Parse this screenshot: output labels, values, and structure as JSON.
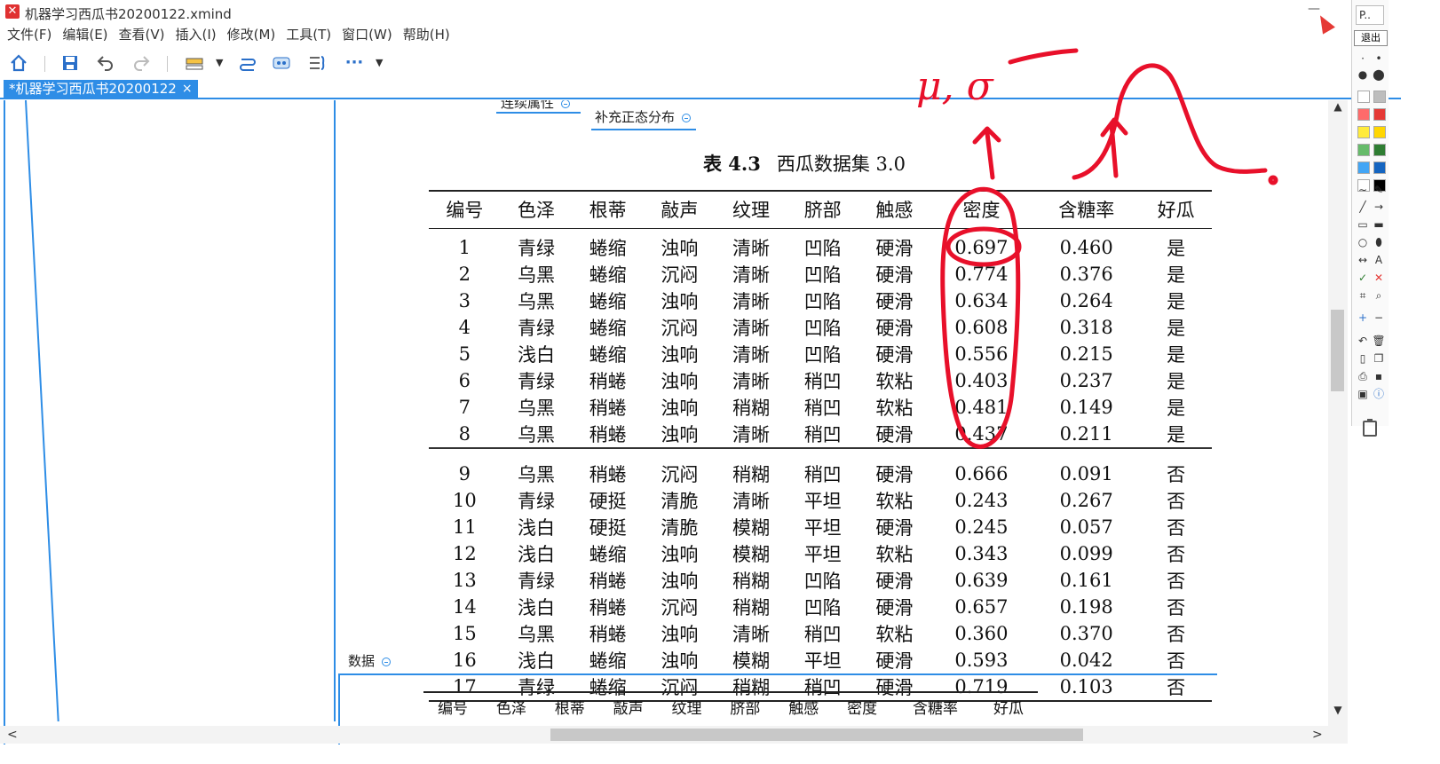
{
  "window": {
    "title": "机器学习西瓜书20200122.xmind",
    "logo_glyph": "✕",
    "minimize_glyph": "—"
  },
  "menu": [
    {
      "label": "文件(F)"
    },
    {
      "label": "编辑(E)"
    },
    {
      "label": "查看(V)"
    },
    {
      "label": "插入(I)"
    },
    {
      "label": "修改(M)"
    },
    {
      "label": "工具(T)"
    },
    {
      "label": "窗口(W)"
    },
    {
      "label": "帮助(H)"
    }
  ],
  "toolbar": {
    "icons": [
      "home-icon",
      "save-icon",
      "undo-icon",
      "redo-icon",
      "topic-icon",
      "relationship-icon",
      "boundary-icon",
      "summary-icon",
      "more-icon"
    ],
    "more_glyph": "···"
  },
  "tab": {
    "label": "*机器学习西瓜书20200122",
    "close_glyph": "×"
  },
  "mindmap": {
    "node_continuous": "连续属性",
    "node_supplement": "补充正态分布",
    "node_data": "数据"
  },
  "table_title": {
    "label": "表 4.3",
    "name": "西瓜数据集 3.0"
  },
  "table": {
    "headers": [
      "编号",
      "色泽",
      "根蒂",
      "敲声",
      "纹理",
      "脐部",
      "触感",
      "密度",
      "含糖率",
      "好瓜"
    ],
    "rows": [
      [
        "1",
        "青绿",
        "蜷缩",
        "浊响",
        "清晰",
        "凹陷",
        "硬滑",
        "0.697",
        "0.460",
        "是"
      ],
      [
        "2",
        "乌黑",
        "蜷缩",
        "沉闷",
        "清晰",
        "凹陷",
        "硬滑",
        "0.774",
        "0.376",
        "是"
      ],
      [
        "3",
        "乌黑",
        "蜷缩",
        "浊响",
        "清晰",
        "凹陷",
        "硬滑",
        "0.634",
        "0.264",
        "是"
      ],
      [
        "4",
        "青绿",
        "蜷缩",
        "沉闷",
        "清晰",
        "凹陷",
        "硬滑",
        "0.608",
        "0.318",
        "是"
      ],
      [
        "5",
        "浅白",
        "蜷缩",
        "浊响",
        "清晰",
        "凹陷",
        "硬滑",
        "0.556",
        "0.215",
        "是"
      ],
      [
        "6",
        "青绿",
        "稍蜷",
        "浊响",
        "清晰",
        "稍凹",
        "软粘",
        "0.403",
        "0.237",
        "是"
      ],
      [
        "7",
        "乌黑",
        "稍蜷",
        "浊响",
        "稍糊",
        "稍凹",
        "软粘",
        "0.481",
        "0.149",
        "是"
      ],
      [
        "8",
        "乌黑",
        "稍蜷",
        "浊响",
        "清晰",
        "稍凹",
        "硬滑",
        "0.437",
        "0.211",
        "是"
      ],
      [
        "9",
        "乌黑",
        "稍蜷",
        "沉闷",
        "稍糊",
        "稍凹",
        "硬滑",
        "0.666",
        "0.091",
        "否"
      ],
      [
        "10",
        "青绿",
        "硬挺",
        "清脆",
        "清晰",
        "平坦",
        "软粘",
        "0.243",
        "0.267",
        "否"
      ],
      [
        "11",
        "浅白",
        "硬挺",
        "清脆",
        "模糊",
        "平坦",
        "硬滑",
        "0.245",
        "0.057",
        "否"
      ],
      [
        "12",
        "浅白",
        "蜷缩",
        "浊响",
        "模糊",
        "平坦",
        "软粘",
        "0.343",
        "0.099",
        "否"
      ],
      [
        "13",
        "青绿",
        "稍蜷",
        "浊响",
        "稍糊",
        "凹陷",
        "硬滑",
        "0.639",
        "0.161",
        "否"
      ],
      [
        "14",
        "浅白",
        "稍蜷",
        "沉闷",
        "稍糊",
        "凹陷",
        "硬滑",
        "0.657",
        "0.198",
        "否"
      ],
      [
        "15",
        "乌黑",
        "稍蜷",
        "浊响",
        "清晰",
        "稍凹",
        "软粘",
        "0.360",
        "0.370",
        "否"
      ],
      [
        "16",
        "浅白",
        "蜷缩",
        "浊响",
        "模糊",
        "平坦",
        "硬滑",
        "0.593",
        "0.042",
        "否"
      ],
      [
        "17",
        "青绿",
        "蜷缩",
        "沉闷",
        "稍糊",
        "稍凹",
        "硬滑",
        "0.719",
        "0.103",
        "否"
      ]
    ]
  },
  "table2": {
    "headers": [
      "编号",
      "色泽",
      "根蒂",
      "敲声",
      "纹理",
      "脐部",
      "触感",
      "密度",
      "含糖率",
      "好瓜"
    ]
  },
  "handwriting": {
    "label": "μ, σ",
    "color": "#e8102a"
  },
  "palette": {
    "top_label": "P..",
    "exit_label": "退出",
    "colors": [
      "#ffffff",
      "#bdbdbd",
      "#ff6b6b",
      "#e53935",
      "#ffeb3b",
      "#ffd600",
      "#66bb6a",
      "#2e7d32",
      "#42a5f5",
      "#1565c0",
      "#ffffff",
      "#000000"
    ]
  },
  "scroll": {
    "up": "▲",
    "down": "▼",
    "left": "<",
    "right": ">"
  },
  "colors": {
    "accent": "#2e8de6",
    "tab_bg": "#2e8de6"
  }
}
